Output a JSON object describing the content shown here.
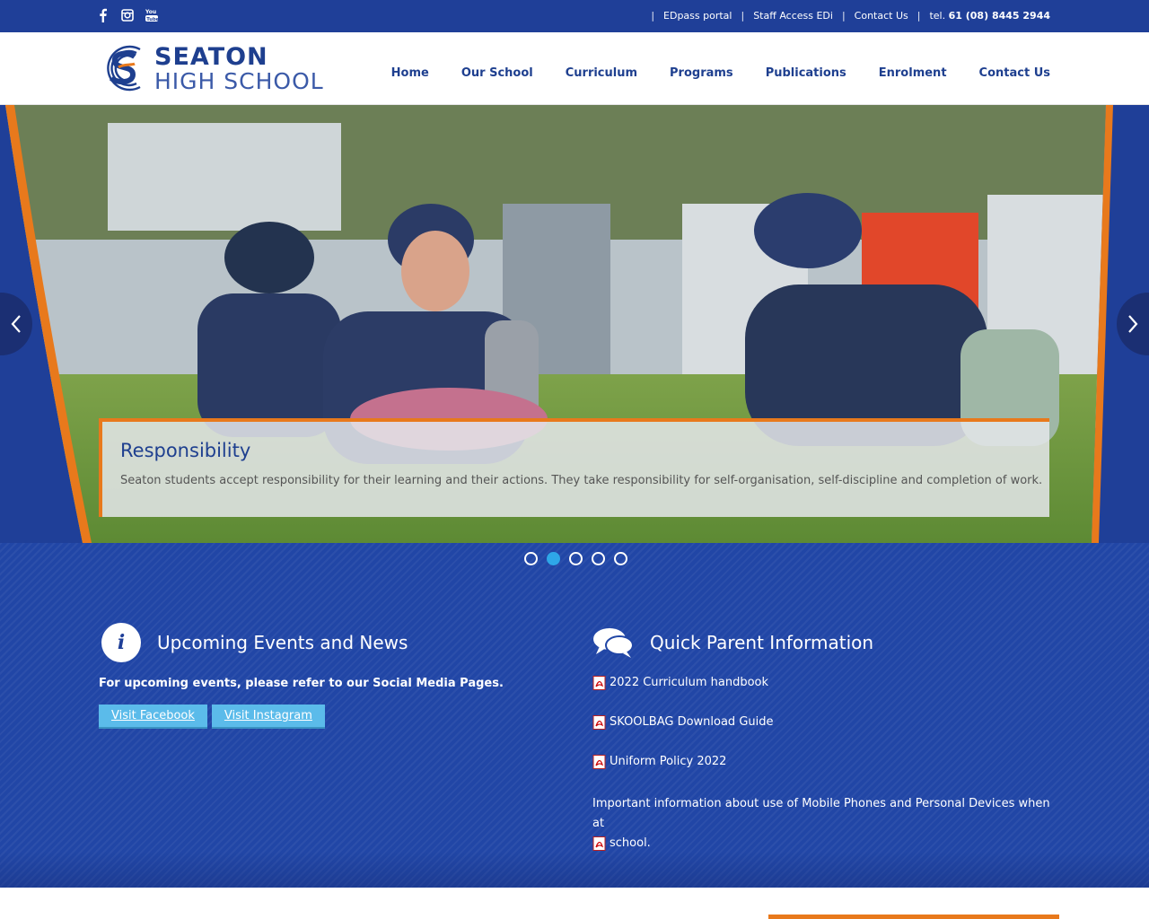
{
  "topbar": {
    "social": [
      "facebook-icon",
      "instagram-icon",
      "youtube-icon"
    ],
    "links": [
      "EDpass portal",
      "Staff Access EDi",
      "Contact Us"
    ],
    "tel_prefix": "tel.",
    "tel_number": "61 (08) 8445 2944",
    "separator": "|"
  },
  "header": {
    "logo_line1": "SEATON",
    "logo_line2": "HIGH SCHOOL",
    "nav": [
      "Home",
      "Our School",
      "Curriculum",
      "Programs",
      "Publications",
      "Enrolment",
      "Contact Us"
    ]
  },
  "hero": {
    "caption_title": "Responsibility",
    "caption_text": "Seaton students accept responsibility for their learning and their actions. They take responsibility for self-organisation, self-discipline and completion of work.",
    "prev_icon": "chevron-left-icon",
    "next_icon": "chevron-right-icon",
    "slides": 5,
    "active_slide": 2
  },
  "events": {
    "title": "Upcoming Events and News",
    "icon": "info-icon",
    "lead": "For upcoming events, please refer to our Social Media Pages.",
    "buttons": [
      "Visit Facebook",
      "Visit Instagram"
    ]
  },
  "parent_info": {
    "title": "Quick Parent Information",
    "icon": "chat-bubbles-icon",
    "items": [
      "2022 Curriculum handbook",
      "SKOOLBAG Download Guide",
      "Uniform Policy 2022"
    ],
    "note_line1": "Important information about use of Mobile Phones and Personal Devices when at",
    "note_line2": "school."
  },
  "colors": {
    "brand_blue": "#1f3f98",
    "accent_orange": "#e8791c",
    "button_blue": "#5bbbea"
  }
}
